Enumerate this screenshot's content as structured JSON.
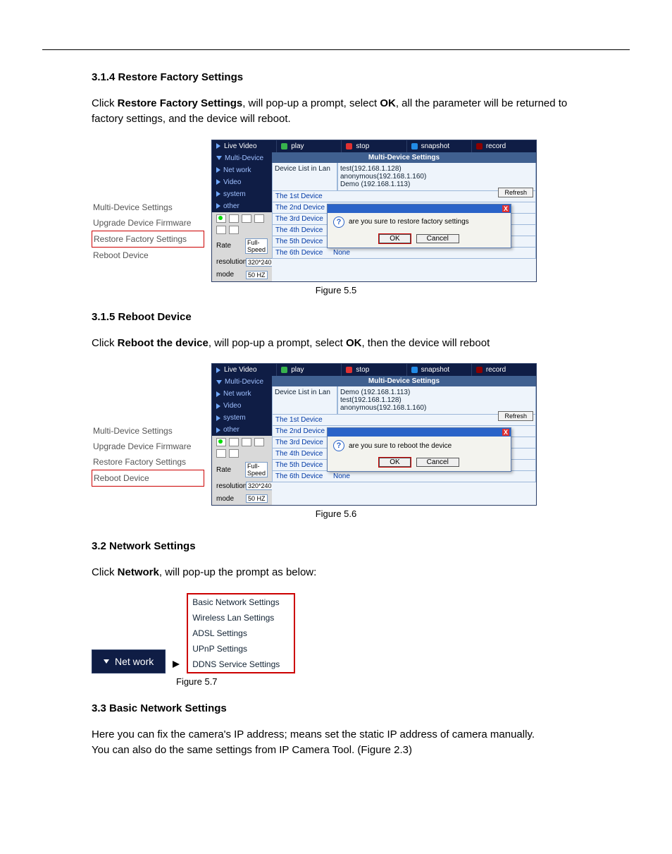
{
  "sections": {
    "s1": {
      "heading": "3.1.4 Restore Factory Settings",
      "para_a": "Click ",
      "para_b": "Restore Factory Settings",
      "para_c": ", will pop-up a prompt, select ",
      "para_d": "OK",
      "para_e": ", all the parameter will be returned to factory settings, and the device will reboot."
    },
    "s2": {
      "heading": "3.1.5 Reboot Device",
      "para_a": "Click ",
      "para_b": "Reboot the device",
      "para_c": ", will pop-up a prompt, select ",
      "para_d": "OK",
      "para_e": ", then the device will reboot"
    },
    "s3": {
      "heading": "3.2 Network Settings",
      "para_a": "Click ",
      "para_b": "Network",
      "para_c": ", will pop-up the prompt as below:"
    },
    "s4": {
      "heading": "3.3 Basic Network Settings",
      "line1": "Here you can fix the camera's IP address; means set the static IP address of camera manually.",
      "line2": "You can also do the same settings from IP Camera Tool. (Figure 2.3)"
    }
  },
  "captions": {
    "c1": "Figure 5.5",
    "c2": "Figure 5.6",
    "c3": "Figure 5.7"
  },
  "side_menu": {
    "m1": "Multi-Device Settings",
    "m2": "Upgrade Device Firmware",
    "m3": "Restore Factory Settings",
    "m4": "Reboot Device"
  },
  "app": {
    "top": {
      "live": "Live Video",
      "play": "play",
      "stop": "stop",
      "snapshot": "snapshot",
      "record": "record"
    },
    "left": {
      "multi": "Multi-Device",
      "net": "Net work",
      "video": "Video",
      "system": "system",
      "other": "other",
      "rate_lbl": "Rate",
      "rate_val": "Full-Speed",
      "res_lbl": "resolution",
      "res_val": "320*240",
      "mode_lbl": "mode",
      "mode_val": "50 HZ"
    },
    "right": {
      "title": "Multi-Device Settings",
      "list_label": "Device List in Lan",
      "refresh": "Refresh",
      "serversA": {
        "a": "test(192.168.1.128)",
        "b": "anonymous(192.168.1.160)",
        "c": "Demo (192.168.1.113)"
      },
      "serversB": {
        "a": "Demo (192.168.1.113)",
        "b": "test(192.168.1.128)",
        "c": "anonymous(192.168.1.160)"
      },
      "devices": {
        "d1": "The 1st Device",
        "d2": "The 2nd Device",
        "d3": "The 3rd Device",
        "d4": "The 4th Device",
        "d5": "The 5th Device",
        "d6": "The 6th Device",
        "none": "None"
      }
    },
    "dialog": {
      "msg1": "are you sure to restore factory settings",
      "msg2": "are you sure to reboot the device",
      "ok": "OK",
      "cancel": "Cancel",
      "x": "X"
    }
  },
  "network": {
    "btn": "Net work",
    "items": {
      "a": "Basic Network Settings",
      "b": "Wireless Lan Settings",
      "c": "ADSL Settings",
      "d": "UPnP Settings",
      "e": "DDNS Service Settings"
    }
  }
}
